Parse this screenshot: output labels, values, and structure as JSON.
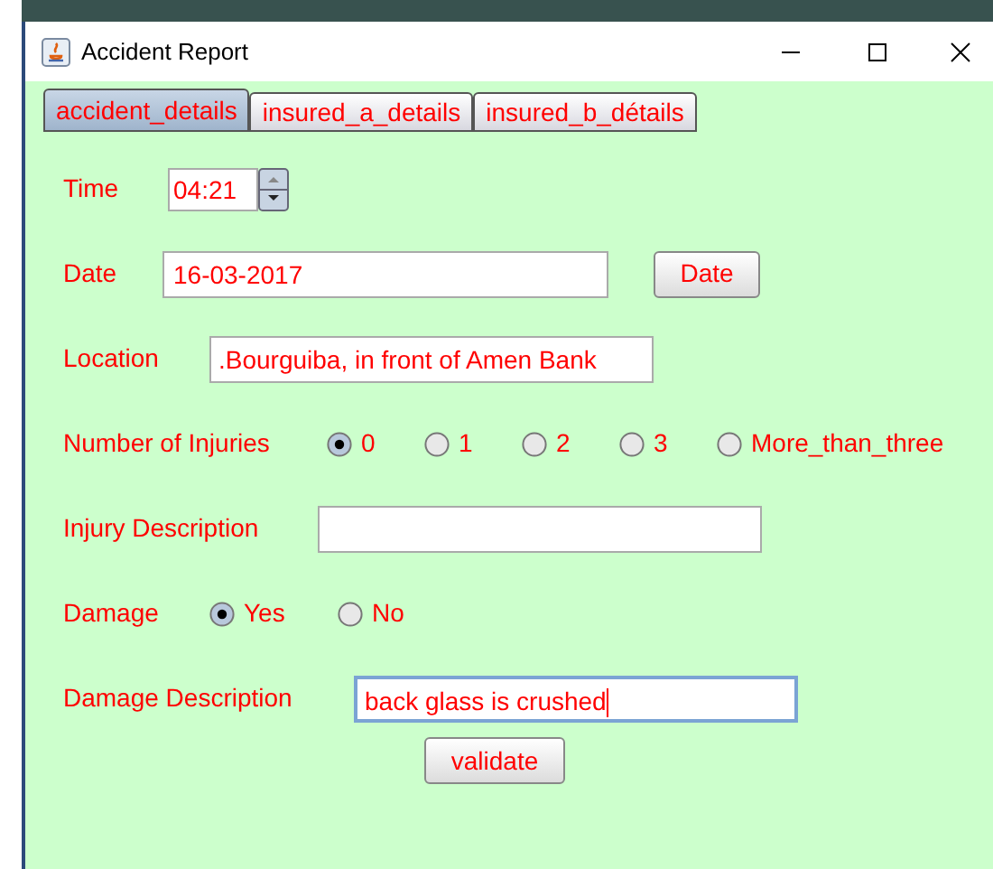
{
  "window": {
    "title": "Accident Report"
  },
  "tabs": [
    {
      "label": "accident_details",
      "selected": true
    },
    {
      "label": "insured_a_details",
      "selected": false
    },
    {
      "label": "insured_b_détails",
      "selected": false
    }
  ],
  "form": [
    {
      "kind": "time",
      "label": "Time",
      "value": "04:21"
    },
    {
      "kind": "date",
      "label": "Date",
      "value": "16-03-2017",
      "button": "Date"
    },
    {
      "kind": "text",
      "label": "Location",
      "value": ".Bourguiba, in front of Amen Bank",
      "focused": false
    },
    {
      "kind": "radio",
      "label": "Number of Injuries",
      "options": [
        {
          "label": "0",
          "selected": true
        },
        {
          "label": "1",
          "selected": false
        },
        {
          "label": "2",
          "selected": false
        },
        {
          "label": "3",
          "selected": false
        },
        {
          "label": "More_than_three",
          "selected": false
        }
      ]
    },
    {
      "kind": "text",
      "label": "Injury Description",
      "focused": false
    },
    {
      "kind": "radio",
      "label": "Damage",
      "options": [
        {
          "label": "Yes",
          "selected": true
        },
        {
          "label": "No",
          "selected": false
        }
      ]
    },
    {
      "kind": "text",
      "label": "Damage Description",
      "value": "back glass is crushed",
      "focused": true
    }
  ],
  "submit": "validate"
}
